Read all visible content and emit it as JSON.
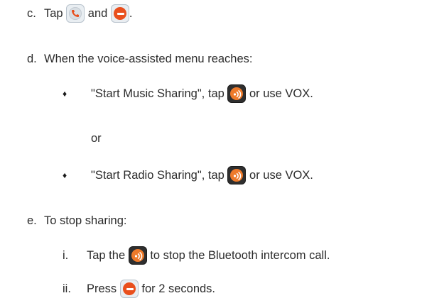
{
  "steps": {
    "c": {
      "marker": "c.",
      "text_before": "Tap",
      "text_middle": "and",
      "text_end": "."
    },
    "d": {
      "marker": "d.",
      "text": "When the voice-assisted menu reaches:",
      "bullet1": {
        "text_before": "\"Start Music Sharing\", tap",
        "text_after": "or use VOX."
      },
      "or_text": "or",
      "bullet2": {
        "text_before": "\"Start Radio Sharing\", tap",
        "text_after": "or use VOX."
      }
    },
    "e": {
      "marker": "e.",
      "text": "To stop sharing:",
      "sub_i": {
        "marker": "i.",
        "text_before": "Tap the",
        "text_after": "to stop the Bluetooth intercom call."
      },
      "sub_ii": {
        "marker": "ii.",
        "text_before": "Press",
        "text_after": "for 2 seconds."
      }
    }
  },
  "bullet_glyph": "♦",
  "icons": {
    "phone": "phone-button-icon",
    "minus": "minus-button-icon",
    "share": "sharing-button-icon"
  },
  "colors": {
    "text": "#2b2b2b",
    "accent_orange": "#e94f1d",
    "share_orange": "#ee7a2a"
  }
}
